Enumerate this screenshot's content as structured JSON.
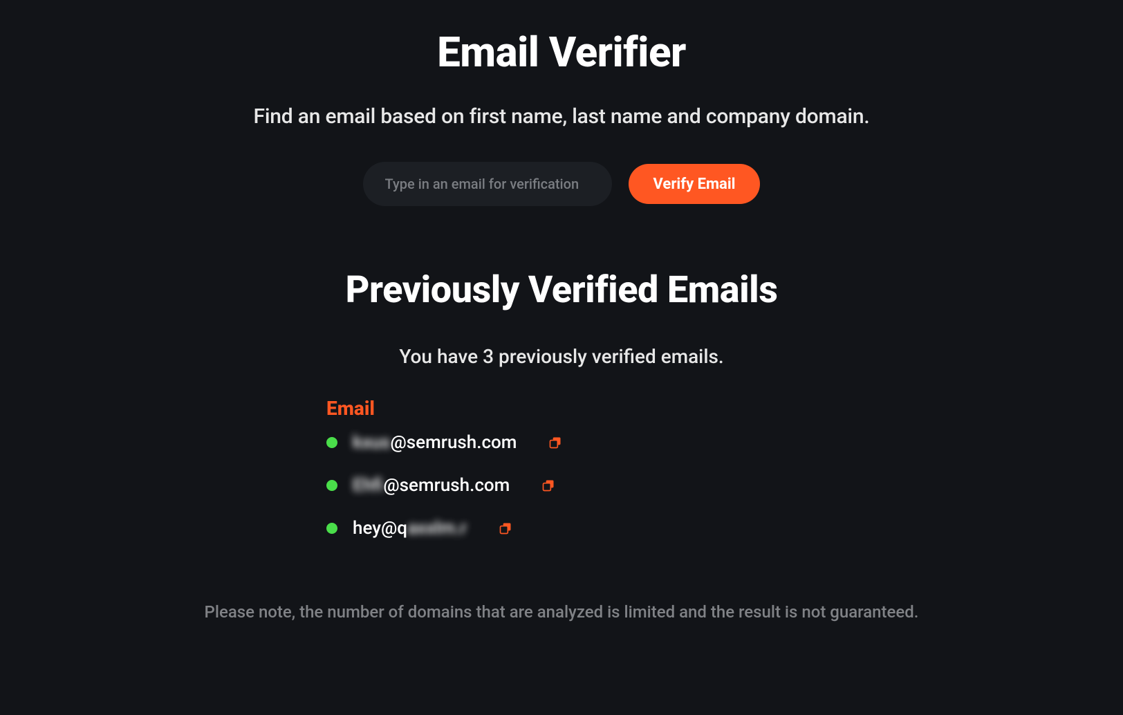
{
  "header": {
    "title": "Email Verifier",
    "subtitle": "Find an email based on first name, last name and company domain."
  },
  "form": {
    "input_placeholder": "Type in an email for verification",
    "button_label": "Verify Email"
  },
  "previous": {
    "title": "Previously Verified Emails",
    "subtitle": "You have 3 previously verified emails.",
    "column_header": "Email",
    "emails": [
      {
        "prefix_blurred": "kxus",
        "suffix": "@semrush.com",
        "status": "verified"
      },
      {
        "prefix_blurred": "Ehfi",
        "suffix": "@semrush.com",
        "status": "verified"
      },
      {
        "prefix": "hey@q",
        "suffix_blurred": "axxlm.r",
        "status": "verified"
      }
    ]
  },
  "footer": {
    "note": "Please note, the number of domains that are analyzed is limited and the result is not guaranteed."
  },
  "colors": {
    "accent": "#ff5722",
    "status_ok": "#4ade4a",
    "background": "#121418"
  }
}
